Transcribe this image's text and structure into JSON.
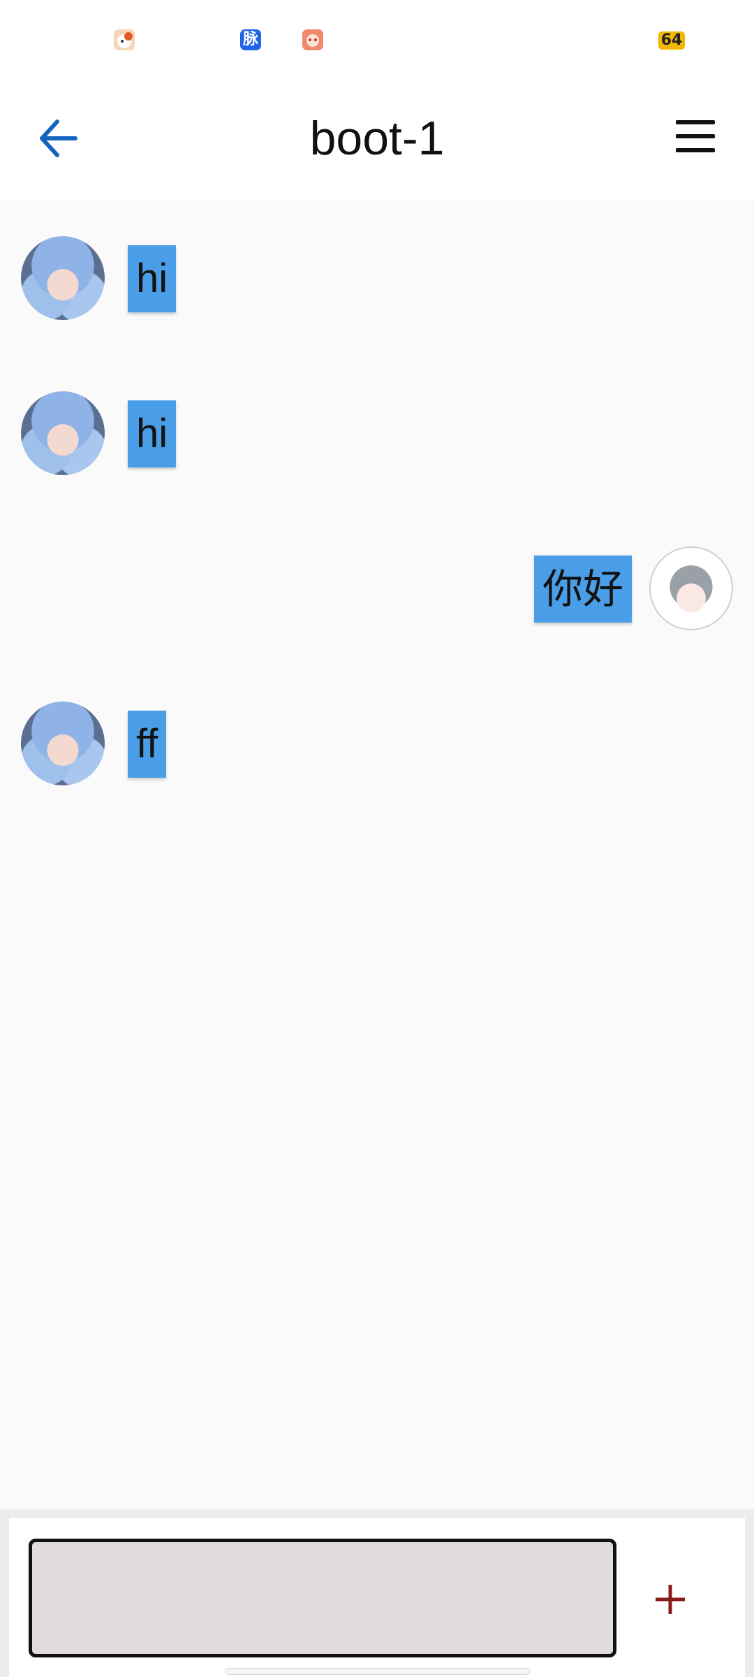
{
  "status_bar": {
    "icons": [
      "bear-app-icon",
      "mai-app-icon",
      "mascot-app-icon"
    ],
    "mai_label": "脉",
    "battery": "64"
  },
  "header": {
    "title": "boot-1",
    "back_icon": "arrow-left-icon",
    "menu_icon": "hamburger-menu-icon"
  },
  "messages": [
    {
      "sender": "bot",
      "text": "hi"
    },
    {
      "sender": "bot",
      "text": "hi"
    },
    {
      "sender": "user",
      "text": "你好"
    },
    {
      "sender": "bot",
      "text": "ff"
    }
  ],
  "composer": {
    "input_value": "",
    "add_icon": "plus-icon"
  },
  "colors": {
    "accent": "#1565c0",
    "bubble": "#4a9ee8",
    "add_button": "#8b1a1a",
    "battery": "#f2b705"
  }
}
